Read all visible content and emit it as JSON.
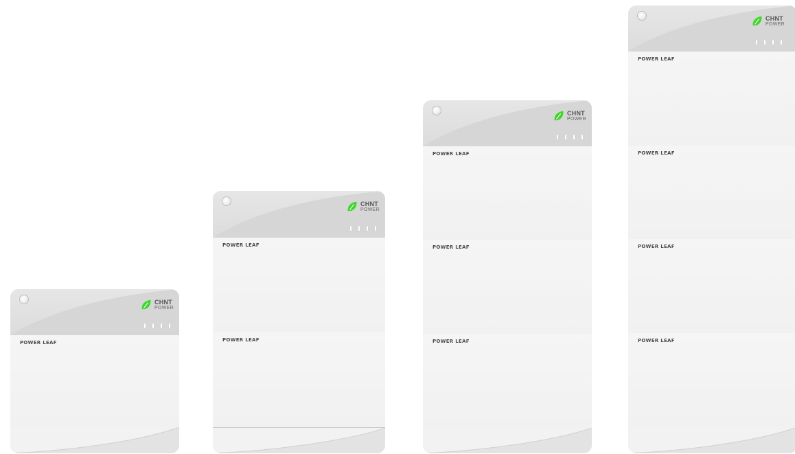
{
  "brand": {
    "name": "CHNT",
    "sub": "POWER"
  },
  "module_label": "POWER LEAF",
  "colors": {
    "leaf": "#3fd62a",
    "body": "#f3f3f3",
    "cap": "#e0e0e0"
  },
  "stacks": [
    {
      "modules": [
        "POWER LEAF"
      ]
    },
    {
      "modules": [
        "POWER LEAF",
        "POWER LEAF"
      ]
    },
    {
      "modules": [
        "POWER LEAF",
        "POWER LEAF",
        "POWER LEAF"
      ]
    },
    {
      "modules": [
        "POWER LEAF",
        "POWER LEAF",
        "POWER LEAF",
        "POWER LEAF"
      ]
    }
  ]
}
